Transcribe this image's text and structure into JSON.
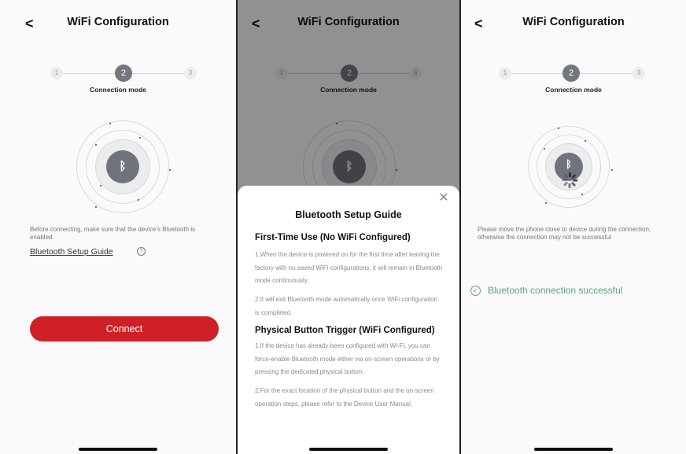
{
  "screen1": {
    "title": "WiFi Configuration",
    "steps": [
      "1",
      "2",
      "3"
    ],
    "active_step": 2,
    "step_caption": "Connection mode",
    "hint": "Before connecting, make sure that the device's Bluetooth is enabled.",
    "guide_link": "Bluetooth Setup Guide",
    "connect_label": "Connect"
  },
  "screen2": {
    "title": "WiFi Configuration",
    "steps": [
      "1",
      "2",
      "3"
    ],
    "step_caption": "Connection mode",
    "sheet": {
      "title": "Bluetooth Setup Guide",
      "section1_title": "First-Time Use (No WiFi Configured)",
      "section1_p1": "1.When the device is powered on for the first time after leaving the factory with no saved WiFi configurations, it will remain in Bluetooth mode continuously.",
      "section1_p2": "2.It will exit Bluetooth mode automatically once WiFi configuration is completed.",
      "section2_title": "Physical Button Trigger (WiFi Configured)",
      "section2_p1": "1.If the device has already been configured with Wi-Fi, you can force-enable Bluetooth mode either via on-screen operations or by pressing the dedicated physical button.",
      "section2_p2": "2.For the exact location of the physical button and the on-screen operation steps, please refer to the Device User Manual."
    }
  },
  "screen3": {
    "title": "WiFi Configuration",
    "steps": [
      "1",
      "2",
      "3"
    ],
    "step_caption": "Connection mode",
    "hint": "Please move the phone close to device during the connection, otherwise the connection may not be successful",
    "success_text": "Bluetooth connection successful"
  },
  "icons": {
    "back": "back-chevron-icon",
    "bluetooth": "bluetooth-icon",
    "help": "help-circle-icon",
    "close": "close-icon",
    "check": "check-circle-icon",
    "spinner": "loading-spinner-icon"
  },
  "colors": {
    "accent_red": "#cf2027",
    "success_green": "#58a57a",
    "step_active": "#72767e"
  }
}
